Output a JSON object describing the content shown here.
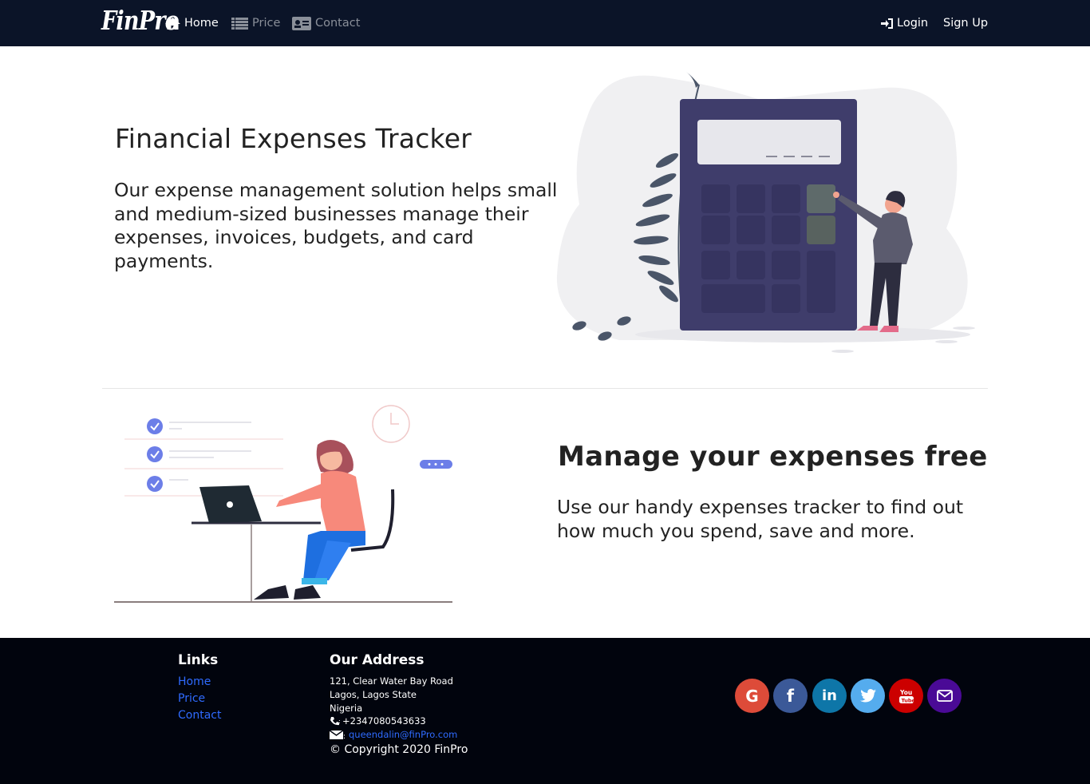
{
  "navbar": {
    "brand": "FinPro",
    "links": [
      {
        "label": "Home",
        "icon": "home-icon",
        "active": true
      },
      {
        "label": "Price",
        "icon": "list-icon",
        "active": false
      },
      {
        "label": "Contact",
        "icon": "contact-card-icon",
        "active": false
      }
    ],
    "login": "Login",
    "signup": "Sign Up"
  },
  "hero": {
    "title": "Financial Expenses Tracker",
    "text": "Our expense management solution helps small and medium-sized businesses manage their expenses, invoices, budgets, and card payments."
  },
  "section2": {
    "title": "Manage your expenses free",
    "text": "Use our handy expenses tracker to find out how much you spend, save and more."
  },
  "footer": {
    "links_heading": "Links",
    "links": [
      "Home",
      "Price",
      "Contact"
    ],
    "address_heading": "Our Address",
    "address_lines": [
      "121, Clear Water Bay Road",
      "Lagos, Lagos State",
      "Nigeria"
    ],
    "phone": "+2347080543633",
    "email": "queendalin@finPro.com",
    "copyright": "© Copyright 2020 FinPro",
    "social": [
      {
        "name": "google",
        "glyph": "G",
        "color": "#dd4b39"
      },
      {
        "name": "facebook",
        "glyph": "f",
        "color": "#3b5998"
      },
      {
        "name": "linkedin",
        "glyph": "in",
        "color": "#0e76a8"
      },
      {
        "name": "twitter",
        "glyph": "t",
        "color": "#55acee"
      },
      {
        "name": "youtube",
        "glyph": "You",
        "color": "#cc0000"
      },
      {
        "name": "email",
        "glyph": "mail",
        "color": "#4a0a96"
      }
    ]
  },
  "colors": {
    "navbar_bg": "#0b1428",
    "footer_bg": "#01040d",
    "link_blue": "#2f6bff",
    "calculator": "#3f3d6b"
  }
}
